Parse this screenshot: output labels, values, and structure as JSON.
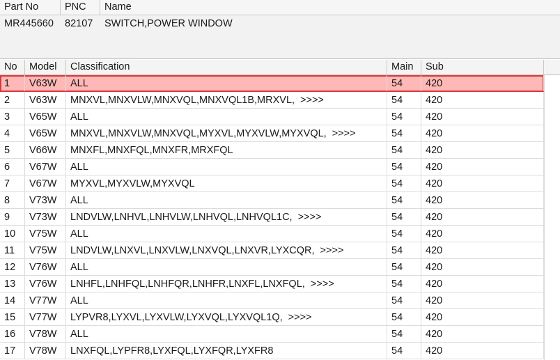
{
  "part_info": {
    "headers": {
      "part_no": "Part No",
      "pnc": "PNC",
      "name": "Name"
    },
    "row": {
      "part_no": "MR445660",
      "pnc": "82107",
      "name": "SWITCH,POWER WINDOW"
    }
  },
  "grid": {
    "headers": {
      "no": "No",
      "model": "Model",
      "classification": "Classification",
      "main": "Main",
      "sub": "Sub"
    },
    "more_indicator": ">>>>",
    "selected_row_index": 0,
    "selection_color": "#ffb8b8",
    "rows": [
      {
        "no": "1",
        "model": "V63W",
        "classification": "ALL",
        "more": "",
        "main": "54",
        "sub": "420"
      },
      {
        "no": "2",
        "model": "V63W",
        "classification": "MNXVL,MNXVLW,MNXVQL,MNXVQL1B,MRXVL,",
        "more": ">>>>",
        "main": "54",
        "sub": "420"
      },
      {
        "no": "3",
        "model": "V65W",
        "classification": "ALL",
        "more": "",
        "main": "54",
        "sub": "420"
      },
      {
        "no": "4",
        "model": "V65W",
        "classification": "MNXVL,MNXVLW,MNXVQL,MYXVL,MYXVLW,MYXVQL,",
        "more": ">>>>",
        "main": "54",
        "sub": "420"
      },
      {
        "no": "5",
        "model": "V66W",
        "classification": "MNXFL,MNXFQL,MNXFR,MRXFQL",
        "more": "",
        "main": "54",
        "sub": "420"
      },
      {
        "no": "6",
        "model": "V67W",
        "classification": "ALL",
        "more": "",
        "main": "54",
        "sub": "420"
      },
      {
        "no": "7",
        "model": "V67W",
        "classification": "MYXVL,MYXVLW,MYXVQL",
        "more": "",
        "main": "54",
        "sub": "420"
      },
      {
        "no": "8",
        "model": "V73W",
        "classification": "ALL",
        "more": "",
        "main": "54",
        "sub": "420"
      },
      {
        "no": "9",
        "model": "V73W",
        "classification": "LNDVLW,LNHVL,LNHVLW,LNHVQL,LNHVQL1C,",
        "more": ">>>>",
        "main": "54",
        "sub": "420"
      },
      {
        "no": "10",
        "model": "V75W",
        "classification": "ALL",
        "more": "",
        "main": "54",
        "sub": "420"
      },
      {
        "no": "11",
        "model": "V75W",
        "classification": "LNDVLW,LNXVL,LNXVLW,LNXVQL,LNXVR,LYXCQR,",
        "more": ">>>>",
        "main": "54",
        "sub": "420"
      },
      {
        "no": "12",
        "model": "V76W",
        "classification": "ALL",
        "more": "",
        "main": "54",
        "sub": "420"
      },
      {
        "no": "13",
        "model": "V76W",
        "classification": "LNHFL,LNHFQL,LNHFQR,LNHFR,LNXFL,LNXFQL,",
        "more": ">>>>",
        "main": "54",
        "sub": "420"
      },
      {
        "no": "14",
        "model": "V77W",
        "classification": "ALL",
        "more": "",
        "main": "54",
        "sub": "420"
      },
      {
        "no": "15",
        "model": "V77W",
        "classification": "LYPVR8,LYXVL,LYXVLW,LYXVQL,LYXVQL1Q,",
        "more": ">>>>",
        "main": "54",
        "sub": "420"
      },
      {
        "no": "16",
        "model": "V78W",
        "classification": "ALL",
        "more": "",
        "main": "54",
        "sub": "420"
      },
      {
        "no": "17",
        "model": "V78W",
        "classification": "LNXFQL,LYPFR8,LYXFQL,LYXFQR,LYXFR8",
        "more": "",
        "main": "54",
        "sub": "420"
      }
    ]
  }
}
